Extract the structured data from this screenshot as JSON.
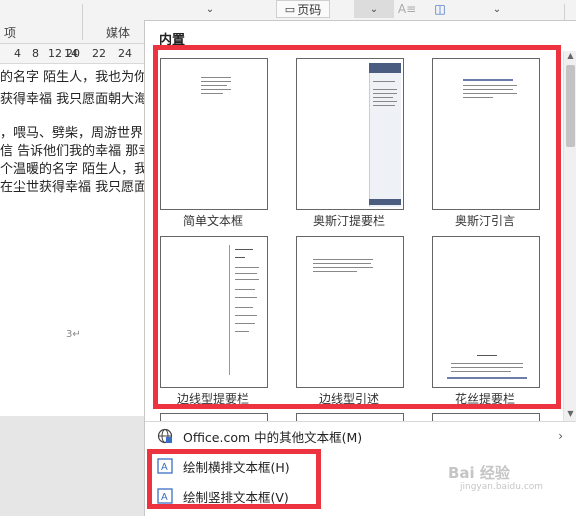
{
  "ribbon": {
    "group_left_label": "项",
    "group_media_label": "媒体",
    "header_footer_btn": "页码"
  },
  "ruler": {
    "ticks": [
      "4",
      "8",
      "12",
      "14",
      "18",
      "20",
      "22",
      "24"
    ]
  },
  "document": {
    "lines": [
      "的名字 陌生人，我也为你",
      "获得幸福 我只愿面朝大海，",
      "，喂马、劈柴，周游世界 从",
      "信 告诉他们我的幸福 那幸",
      "个温暖的名字 陌生人，我",
      "在尘世获得幸福 我只愿面"
    ],
    "page_number": "3"
  },
  "panel": {
    "section_title": "内置",
    "templates": [
      {
        "label": "简单文本框"
      },
      {
        "label": "奥斯汀提要栏"
      },
      {
        "label": "奥斯汀引言"
      },
      {
        "label": "边线型提要栏"
      },
      {
        "label": "边线型引述"
      },
      {
        "label": "花丝提要栏"
      }
    ],
    "menu": {
      "more_label": "Office.com 中的其他文本框(M)",
      "draw_horizontal_label": "绘制横排文本框(H)",
      "draw_vertical_label": "绘制竖排文本框(V)"
    }
  },
  "watermark": {
    "brand": "Bai 经验",
    "site": "jingyan.baidu.com"
  },
  "colors": {
    "highlight": "#ee3340",
    "accent": "#1e5ab4"
  }
}
